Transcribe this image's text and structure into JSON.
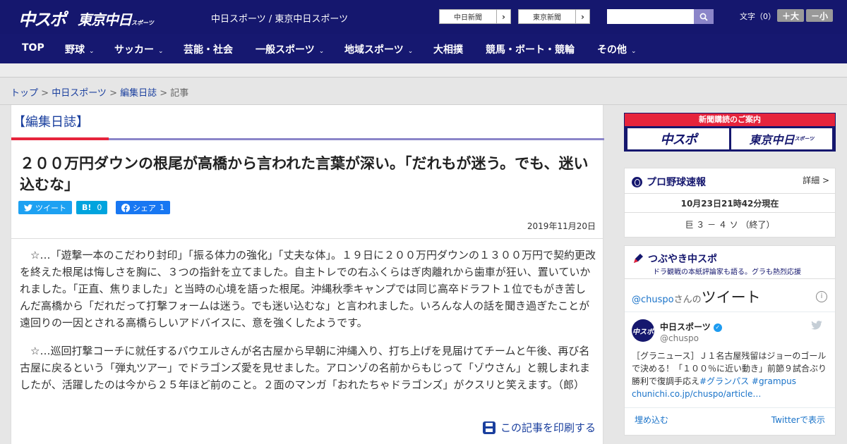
{
  "header": {
    "logo_chuspo": "中スポ",
    "logo_tokyo": "東京中日",
    "logo_tokyo_sub": "スポーツ",
    "site_names": "中日スポーツ / 東京中日スポーツ",
    "ext_links": [
      {
        "label": "中日新聞",
        "arrow": "›"
      },
      {
        "label": "東京新聞",
        "arrow": "›"
      }
    ],
    "search_placeholder": "",
    "fontsize_label": "文字（0）",
    "fontsize_up": "＋大",
    "fontsize_down": "－小"
  },
  "nav": {
    "items": [
      {
        "label": "TOP",
        "chev": ""
      },
      {
        "label": "野球",
        "chev": "⌄"
      },
      {
        "label": "サッカー",
        "chev": "⌄"
      },
      {
        "label": "芸能・社会",
        "chev": ""
      },
      {
        "label": "一般スポーツ",
        "chev": "⌄"
      },
      {
        "label": "地域スポーツ",
        "chev": "⌄"
      },
      {
        "label": "大相撲",
        "chev": ""
      },
      {
        "label": "競馬・ボート・競輪",
        "chev": ""
      },
      {
        "label": "その他",
        "chev": "⌄"
      }
    ]
  },
  "breadcrumb": {
    "top": "トップ",
    "sep": " > ",
    "section": "中日スポーツ",
    "category": "編集日誌",
    "current": "記事"
  },
  "article": {
    "category_title": "【編集日誌】",
    "headline": "２００万円ダウンの根尾が高橋から言われた言葉が深い。「だれもが迷う。でも、迷い込むな」",
    "share": {
      "tweet": "ツイート",
      "hatena": "B!",
      "hatena_count": "0",
      "facebook": "シェア",
      "facebook_count": "1"
    },
    "date": "2019年11月20日",
    "paragraphs": [
      "☆…「遊撃一本のこだわり封印」「振る体力の強化」「丈夫な体」。１９日に２００万円ダウンの１３００万円で契約更改を終えた根尾は悔しさを胸に、３つの指針を立てました。自主トレでの右ふくらはぎ肉離れから歯車が狂い、置いていかれました。「正直、焦りました」と当時の心境を語った根尾。沖縄秋季キャンプでは同じ高卒ドラフト１位でもがき苦しんだ高橋から「だれだって打撃フォームは迷う。でも迷い込むな」と言われました。いろんな人の話を聞き過ぎたことが遠回りの一因とされる高橋らしいアドバイスに、意を強くしたようです。",
      "☆…巡回打撃コーチに就任するパウエルさんが名古屋から早朝に沖縄入り、打ち上げを見届けてチームと午後、再び名古屋に戻るという「弾丸ツアー」でドラゴンズ愛を見せました。アロンゾの名前からもじって「ゾウさん」と親しまれましたが、活躍したのは今から２５年ほど前のこと。２面のマンガ「おれたちゃドラゴンズ」がクスリと笑えます。（郎）"
    ],
    "print_link": "この記事を印刷する"
  },
  "sidebar": {
    "subscription": {
      "title": "新聞購読のご案内",
      "logo1": "中スポ",
      "logo2": "東京中日",
      "logo2_sub": "スポーツ"
    },
    "baseball": {
      "title": "プロ野球速報",
      "detail": "詳細 >",
      "time": "10月23日21時42分現在",
      "score": "巨 ３ － ４ ソ （終了）"
    },
    "tweets": {
      "title": "つぶやき中スポ",
      "subtitle": "ドラ観戦の本紙評論家も語る。グラも熱烈応援",
      "handle": "@chuspo",
      "handle_suffix": "さんの",
      "tweet_word": "ツイート",
      "account_name": "中日スポーツ",
      "account_handle": "@chuspo",
      "avatar_text": "中スポ",
      "tweet_text": "［グラニュース］Ｊ１名古屋残留はジョーのゴールで決める！「１００％に近い動き」前節９試合ぶり勝利で復調手応え",
      "hashtags": "#グランパス #grampus",
      "tweet_link": "chunichi.co.jp/chuspo/article…",
      "embed": "埋め込む",
      "view_on": "Twitterで表示"
    }
  }
}
